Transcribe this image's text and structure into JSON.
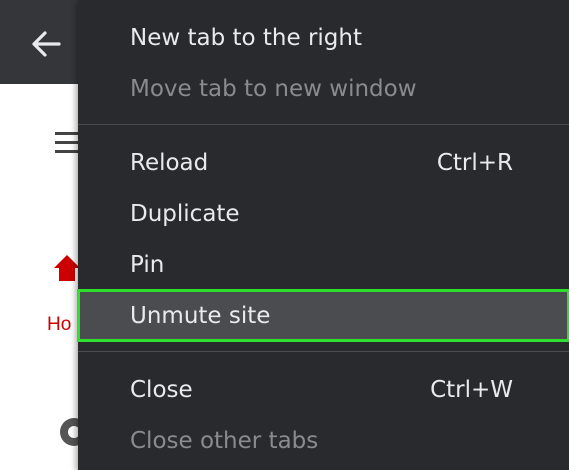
{
  "toolbar": {
    "back_icon": "arrow-left-icon"
  },
  "page": {
    "home_label": "Ho",
    "menu_icon": "hamburger-icon",
    "home_icon": "home-icon",
    "speaker_icon": "speaker-icon"
  },
  "context_menu": {
    "items": [
      {
        "label": "New tab to the right",
        "shortcut": "",
        "disabled": false
      },
      {
        "label": "Move tab to new window",
        "shortcut": "",
        "disabled": true
      },
      {
        "label": "Reload",
        "shortcut": "Ctrl+R",
        "disabled": false
      },
      {
        "label": "Duplicate",
        "shortcut": "",
        "disabled": false
      },
      {
        "label": "Pin",
        "shortcut": "",
        "disabled": false
      },
      {
        "label": "Unmute site",
        "shortcut": "",
        "disabled": false,
        "highlighted": true
      },
      {
        "label": "Close",
        "shortcut": "Ctrl+W",
        "disabled": false
      },
      {
        "label": "Close other tabs",
        "shortcut": "",
        "disabled": true
      }
    ]
  },
  "colors": {
    "menu_bg": "#292a2d",
    "menu_text": "#e8eaed",
    "disabled_text": "#8a8b8e",
    "highlight_bg": "#4b4c4f",
    "highlight_border": "#2ee02e",
    "home_red": "#cc0000"
  }
}
